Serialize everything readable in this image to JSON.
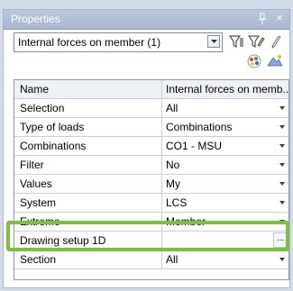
{
  "panel": {
    "title": "Properties",
    "pin_icon": "pin-icon",
    "close_icon": "close-icon"
  },
  "combo": {
    "selected": "Internal forces on member (1)",
    "arrow_icon": "chevron-down-icon"
  },
  "toolbar": {
    "icons": [
      "filter-icon",
      "filter-edit-icon",
      "pencil-icon",
      "color-palette-icon",
      "display-settings-icon"
    ]
  },
  "grid": {
    "header": {
      "name": "Name",
      "value": "Internal forces on memb..."
    },
    "rows": [
      {
        "name": "Selection",
        "value": "All",
        "control": "dropdown"
      },
      {
        "name": "Type of loads",
        "value": "Combinations",
        "control": "dropdown"
      },
      {
        "name": "Combinations",
        "value": "CO1 - MSU",
        "control": "dropdown"
      },
      {
        "name": "Filter",
        "value": "No",
        "control": "dropdown"
      },
      {
        "name": "Values",
        "value": "My",
        "control": "dropdown"
      },
      {
        "name": "System",
        "value": "LCS",
        "control": "dropdown"
      },
      {
        "name": "Extreme",
        "value": "Member",
        "control": "dropdown"
      },
      {
        "name": "Drawing setup 1D",
        "value": "",
        "control": "ellipsis",
        "button_label": "..."
      },
      {
        "name": "Section",
        "value": "All",
        "control": "dropdown"
      }
    ]
  },
  "colors": {
    "highlight": "#7ac143",
    "titlebar": "#a8b6cf",
    "grid_border": "#8e98a8"
  }
}
